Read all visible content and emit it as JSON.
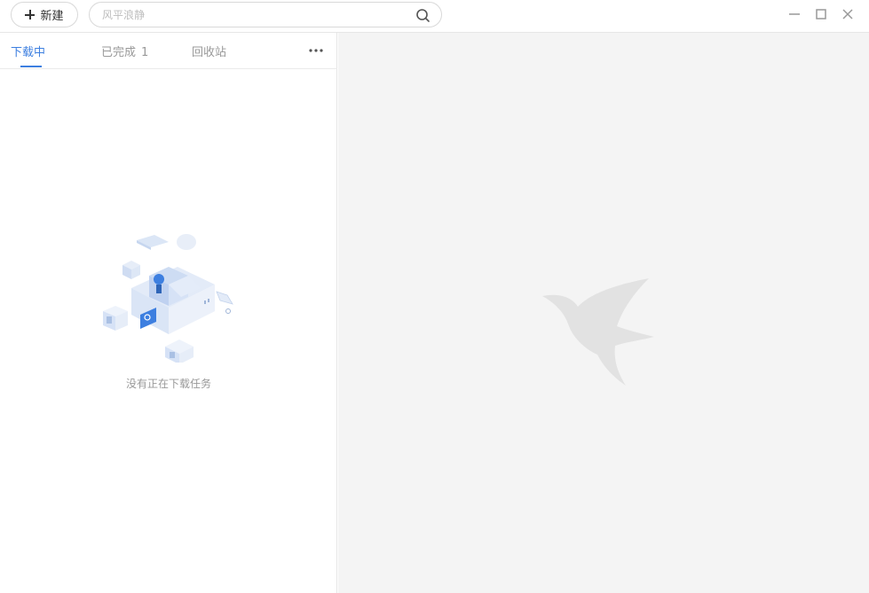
{
  "toolbar": {
    "new_label": "新建",
    "search_placeholder": "风平浪静"
  },
  "tabs": [
    {
      "label": "下载中",
      "count": ""
    },
    {
      "label": "已完成",
      "count": "1"
    },
    {
      "label": "回收站",
      "count": ""
    }
  ],
  "downloading": {
    "empty_text": "没有正在下载任务"
  },
  "colors": {
    "accent": "#3d7fe0",
    "panel_bg": "#f4f4f4"
  },
  "icons": [
    "plus-icon",
    "search-icon",
    "minimize-icon",
    "maximize-icon",
    "close-icon",
    "more-icon",
    "empty-box-illustration",
    "hummingbird-logo"
  ]
}
